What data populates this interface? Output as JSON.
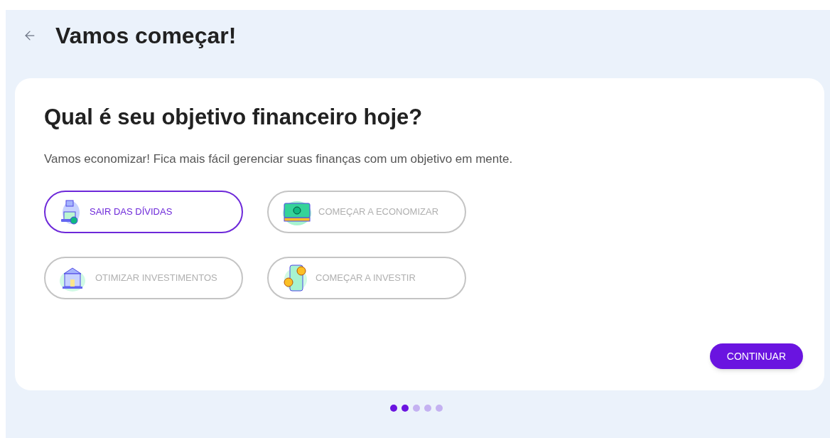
{
  "header": {
    "title": "Vamos começar!"
  },
  "card": {
    "title": "Qual é seu objetivo financeiro hoje?",
    "subtitle": "Vamos economizar! Fica mais fácil gerenciar suas finanças com um objetivo em mente.",
    "options": [
      {
        "label": "SAIR DAS DÍVIDAS",
        "kind": "debt",
        "selected": true
      },
      {
        "label": "COMEÇAR A ECONOMIZAR",
        "kind": "money",
        "selected": false
      },
      {
        "label": "OTIMIZAR INVESTIMENTOS",
        "kind": "bank",
        "selected": false
      },
      {
        "label": "COMEÇAR A INVESTIR",
        "kind": "phone",
        "selected": false
      }
    ],
    "button": "CONTINUAR"
  },
  "steps": [
    {
      "done": true
    },
    {
      "done": true
    },
    {
      "done": false
    },
    {
      "done": false
    },
    {
      "done": false
    }
  ]
}
